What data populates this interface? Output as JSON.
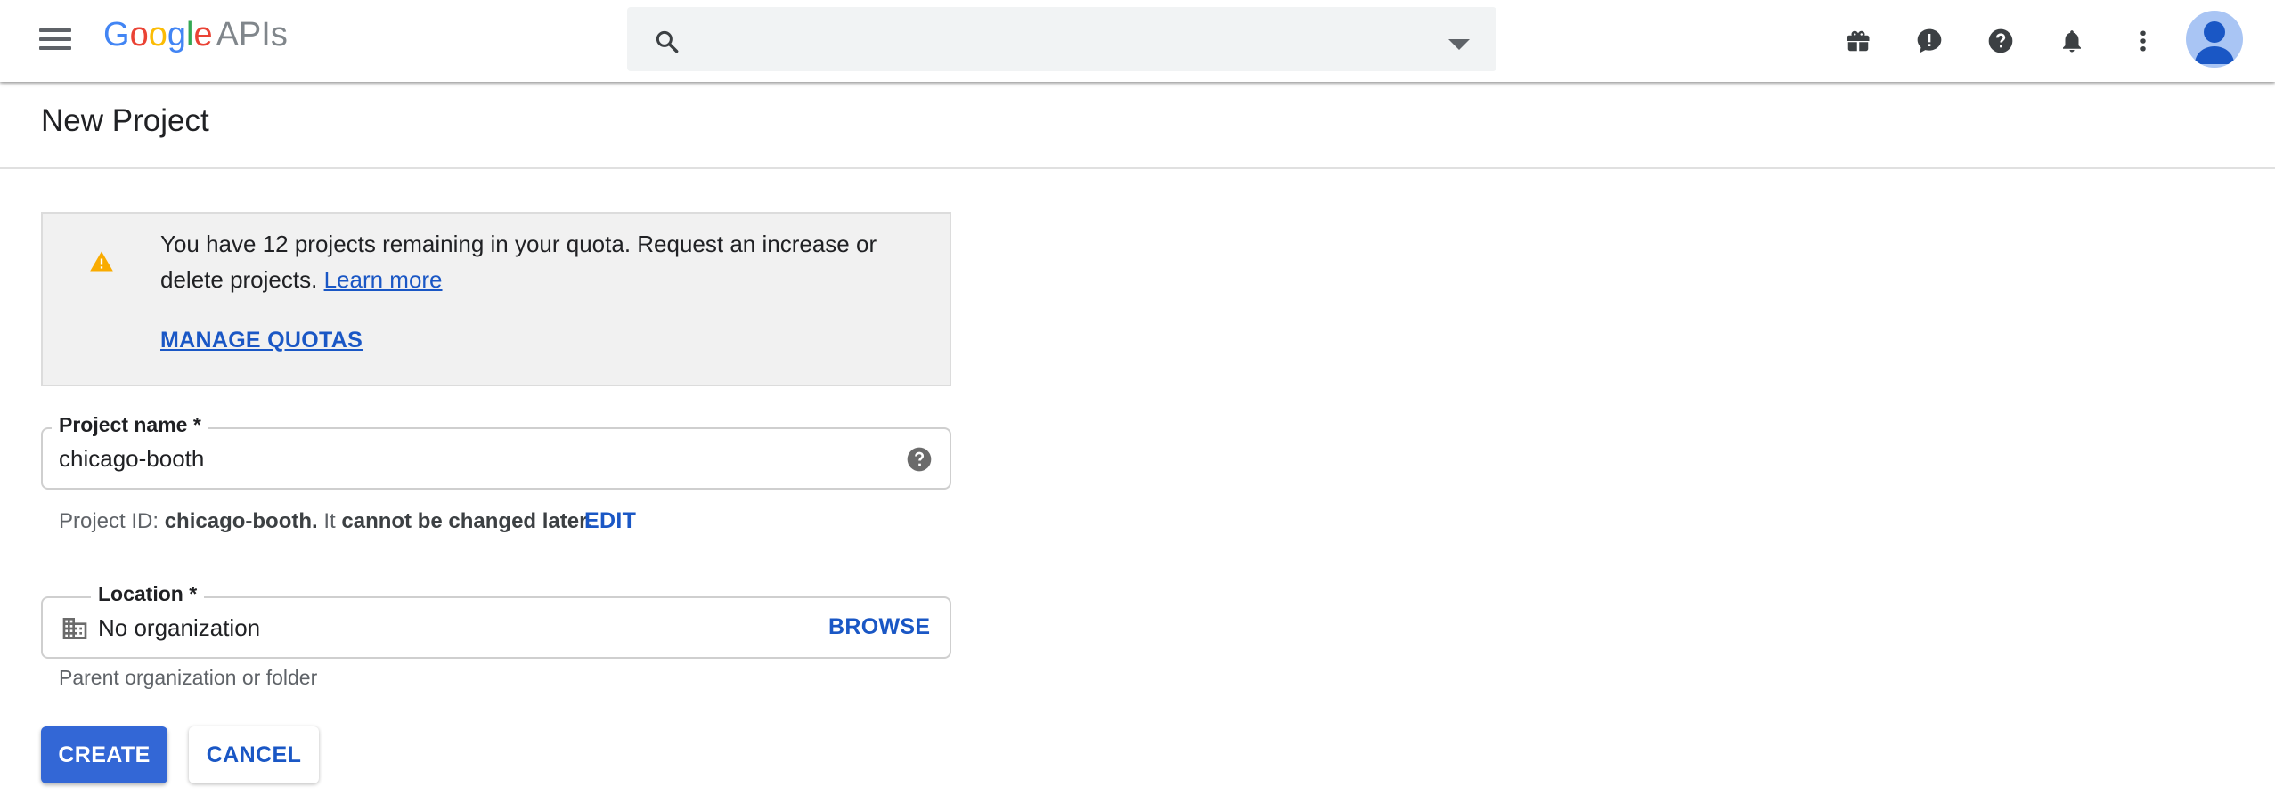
{
  "app": {
    "logo_text": "Google",
    "logo_suffix": "APIs"
  },
  "topbar": {
    "search": {
      "value": "",
      "placeholder": ""
    },
    "icons": [
      "menu-icon",
      "search-icon",
      "dropdown-arrow-icon",
      "gift-icon",
      "feedback-icon",
      "help-icon",
      "notifications-icon",
      "more-vert-icon",
      "account-avatar"
    ]
  },
  "page": {
    "title": "New Project"
  },
  "notice": {
    "message": "You have 12 projects remaining in your quota. Request an increase or delete projects.",
    "learn_more": "Learn more",
    "manage_quotas": "MANAGE QUOTAS",
    "icon": "warning-icon",
    "icon_color": "#f9ab00"
  },
  "project_name": {
    "label": "Project name *",
    "value": "chicago-booth"
  },
  "project_id": {
    "prefix": "Project ID:",
    "id": "chicago-booth.",
    "middle": "It",
    "suffix": "cannot be changed later.",
    "edit": "EDIT"
  },
  "location": {
    "label": "Location *",
    "value": "No organization",
    "browse": "BROWSE",
    "helper": "Parent organization or folder"
  },
  "actions": {
    "create": "CREATE",
    "cancel": "CANCEL"
  },
  "colors": {
    "accent": "#3367d6",
    "link": "#1a57c5",
    "icon_gray": "#5f6368"
  }
}
